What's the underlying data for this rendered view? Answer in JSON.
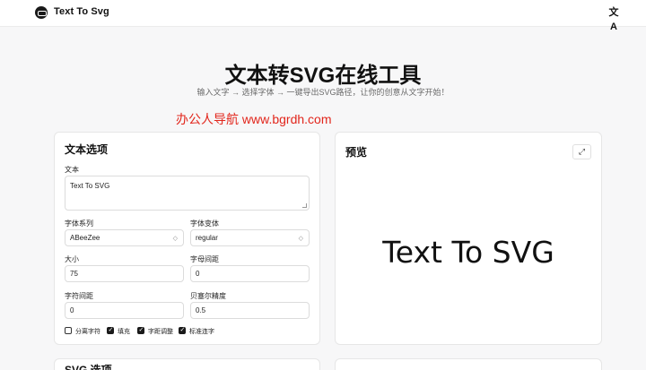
{
  "header": {
    "brand": "Text To Svg",
    "lang_icon": "translate-icon",
    "lang_glyph": "文A"
  },
  "hero": {
    "title": "文本转SVG在线工具",
    "subtitle": "输入文字 → 选择字体 → 一键导出SVG路径，让你的创意从文字开始！",
    "watermark": "办公人导航  www.bgrdh.com"
  },
  "text_options": {
    "title": "文本选项",
    "text_label": "文本",
    "text_value": "Text To SVG",
    "font_family_label": "字体系列",
    "font_family_value": "ABeeZee",
    "font_variant_label": "字体变体",
    "font_variant_value": "regular",
    "size_label": "大小",
    "size_value": "75",
    "letter_spacing_label": "字母间距",
    "letter_spacing_value": "0",
    "char_spacing_label": "字符间距",
    "char_spacing_value": "0",
    "bezier_label": "贝塞尔精度",
    "bezier_value": "0.5",
    "checkboxes": [
      {
        "label": "分离字符",
        "checked": false
      },
      {
        "label": "填充",
        "checked": true
      },
      {
        "label": "字距调整",
        "checked": true
      },
      {
        "label": "标准连字",
        "checked": true
      }
    ]
  },
  "preview": {
    "title": "预览",
    "text": "Text To SVG",
    "expand_icon": "expand-icon"
  },
  "svg_options": {
    "title": "SVG 选项"
  }
}
